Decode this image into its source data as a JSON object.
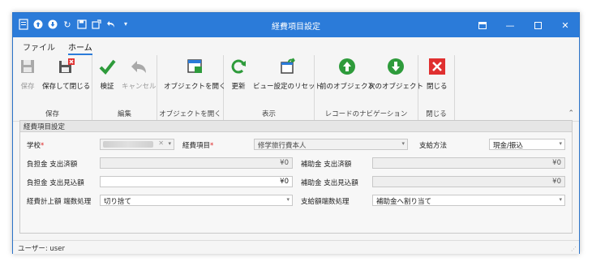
{
  "window": {
    "title": "経費項目設定",
    "controls": [
      "ribbon-display-icon",
      "minimize-icon",
      "maximize-icon",
      "close-icon"
    ]
  },
  "quick_access": [
    "app-icon",
    "upload-icon",
    "download-icon",
    "refresh-icon",
    "save-icon",
    "save-close-icon",
    "undo-icon",
    "chevron-down-icon"
  ],
  "menu": {
    "file": "ファイル",
    "home": "ホーム"
  },
  "ribbon": {
    "save": "保存",
    "save_close": "保存して閉じる",
    "group_save": "保存",
    "verify": "検証",
    "cancel": "キャンセル",
    "group_edit": "編集",
    "open_object": "オブジェクトを開く",
    "group_open": "オブジェクトを開く",
    "refresh": "更新",
    "reset_view": "ビュー設定のリセット",
    "group_view": "表示",
    "prev_object": "前のオブジェクト",
    "next_object": "次のオブジェクト",
    "group_nav": "レコードのナビゲーション",
    "close": "閉じる",
    "group_close": "閉じる",
    "colors": {
      "green": "#2e9b3b",
      "red": "#e03030",
      "blue": "#2b7bd9"
    }
  },
  "form": {
    "header": "経費項目設定",
    "school_label": "学校",
    "expense_item_label": "経費項目",
    "expense_item_value": "修学旅行費本人",
    "payment_method_label": "支給方法",
    "payment_method_value": "現金/振込",
    "burden_spent_label": "負担金 支出済額",
    "burden_spent_value": "¥0",
    "subsidy_spent_label": "補助金 支出済額",
    "subsidy_spent_value": "¥0",
    "burden_forecast_label": "負担金 支出見込額",
    "burden_forecast_value": "¥0",
    "subsidy_forecast_label": "補助金 支出見込額",
    "subsidy_forecast_value": "¥0",
    "rounding_label": "経費計上額 端数処理",
    "rounding_value": "切り捨て",
    "payment_rounding_label": "支給額端数処理",
    "payment_rounding_value": "補助金へ割り当て"
  },
  "status": {
    "user_text": "ユーザー: user"
  }
}
